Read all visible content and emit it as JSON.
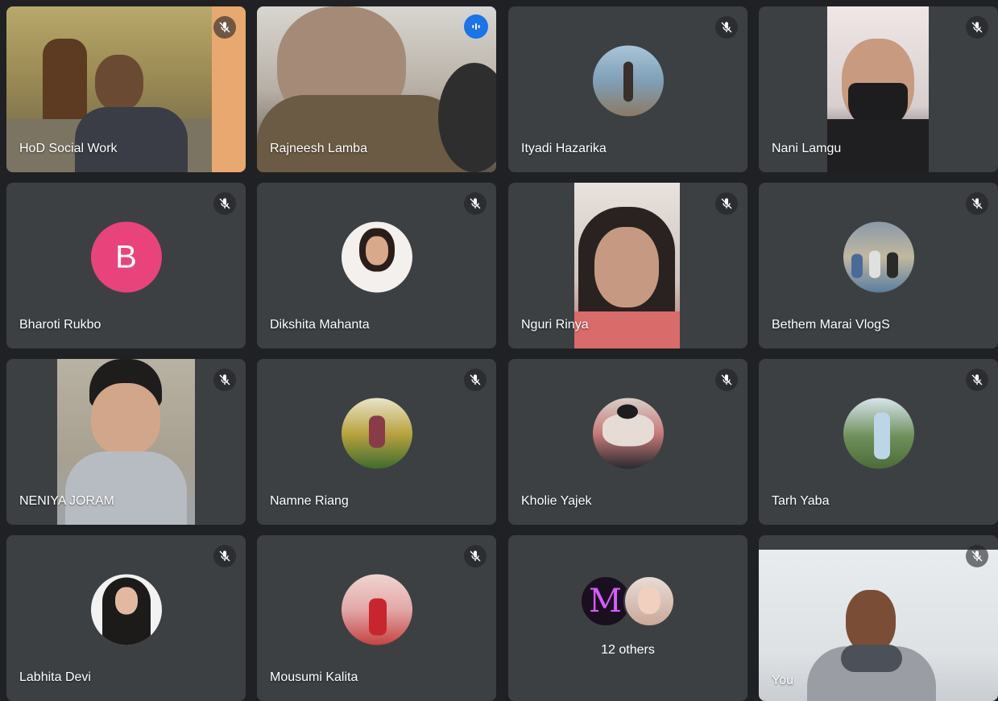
{
  "participants": [
    {
      "name": "HoD Social Work",
      "muted": true,
      "type": "video"
    },
    {
      "name": "Rajneesh Lamba",
      "muted": false,
      "speaking": true,
      "type": "video"
    },
    {
      "name": "Ityadi Hazarika",
      "muted": true,
      "type": "avatar"
    },
    {
      "name": "Nani Lamgu",
      "muted": true,
      "type": "video"
    },
    {
      "name": "Bharoti Rukbo",
      "muted": true,
      "type": "letter",
      "letter": "B",
      "avatar_color": "#e8437a"
    },
    {
      "name": "Dikshita Mahanta",
      "muted": true,
      "type": "avatar"
    },
    {
      "name": "Nguri Rinya",
      "muted": true,
      "type": "video"
    },
    {
      "name": "Bethem Marai VlogS",
      "muted": true,
      "type": "avatar"
    },
    {
      "name": "NENIYA JORAM",
      "muted": true,
      "type": "video"
    },
    {
      "name": "Namne Riang",
      "muted": true,
      "type": "avatar"
    },
    {
      "name": "Kholie Yajek",
      "muted": true,
      "type": "avatar"
    },
    {
      "name": "Tarh Yaba",
      "muted": true,
      "type": "avatar"
    },
    {
      "name": "Labhita Devi",
      "muted": true,
      "type": "avatar"
    },
    {
      "name": "Mousumi Kalita",
      "muted": true,
      "type": "avatar"
    },
    {
      "name": "12 others",
      "type": "others",
      "avatar_letter": "M"
    },
    {
      "name": "You",
      "muted": true,
      "type": "video"
    }
  ],
  "icons": {
    "mute": "mic-off-icon",
    "speaking": "audio-wave-icon"
  },
  "colors": {
    "background": "#202124",
    "tile": "#3c4043",
    "speaking_outline": "#8ab4f8",
    "speaking_badge": "#1a73e8"
  }
}
